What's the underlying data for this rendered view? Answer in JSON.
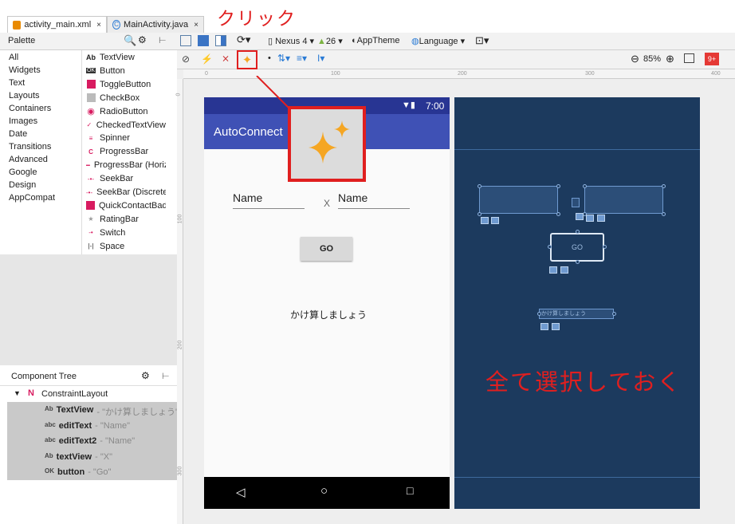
{
  "tabs": [
    {
      "label": "activity_main.xml",
      "close": "×"
    },
    {
      "label": "MainActivity.java",
      "close": "×"
    }
  ],
  "annotation": {
    "click": "クリック",
    "select_all": "全て選択しておく"
  },
  "palette": {
    "title": "Palette",
    "categories": [
      "All",
      "Widgets",
      "Text",
      "Layouts",
      "Containers",
      "Images",
      "Date",
      "Transitions",
      "Advanced",
      "Google",
      "Design",
      "AppCompat"
    ],
    "items": [
      {
        "icon": "Ab",
        "label": "TextView"
      },
      {
        "icon": "OK",
        "label": "Button"
      },
      {
        "icon": "toggle",
        "label": "ToggleButton"
      },
      {
        "icon": "check",
        "label": "CheckBox"
      },
      {
        "icon": "radio",
        "label": "RadioButton"
      },
      {
        "icon": "checked",
        "label": "CheckedTextView"
      },
      {
        "icon": "spinner",
        "label": "Spinner"
      },
      {
        "icon": "progress",
        "label": "ProgressBar"
      },
      {
        "icon": "progressh",
        "label": "ProgressBar (Horizontal)"
      },
      {
        "icon": "seek",
        "label": "SeekBar"
      },
      {
        "icon": "seekd",
        "label": "SeekBar (Discrete)"
      },
      {
        "icon": "qcb",
        "label": "QuickContactBadge"
      },
      {
        "icon": "star",
        "label": "RatingBar"
      },
      {
        "icon": "switch",
        "label": "Switch"
      },
      {
        "icon": "space",
        "label": "Space"
      }
    ]
  },
  "toolbar": {
    "device": "Nexus 4",
    "api": "26",
    "theme": "AppTheme",
    "language": "Language",
    "zoom": "85%",
    "badge": "9+"
  },
  "ruler": {
    "marks": [
      "0",
      "100",
      "200",
      "300",
      "400"
    ],
    "vmarks": [
      "0",
      "100",
      "200",
      "300"
    ]
  },
  "phone": {
    "time": "7:00",
    "app_title": "AutoConnect",
    "name1": "Name",
    "x_label": "X",
    "name2": "Name",
    "go": "GO",
    "text": "かけ算しましょう"
  },
  "blueprint": {
    "go": "GO",
    "text": "かけ算しましょう"
  },
  "component_tree": {
    "title": "Component Tree",
    "root": "ConstraintLayout",
    "items": [
      {
        "icon": "Ab",
        "name": "TextView",
        "value": "- \"かけ算しましょう\""
      },
      {
        "icon": "abc",
        "name": "editText",
        "value": "- \"Name\""
      },
      {
        "icon": "abc",
        "name": "editText2",
        "value": "- \"Name\""
      },
      {
        "icon": "Ab",
        "name": "textView",
        "value": "- \"X\""
      },
      {
        "icon": "OK",
        "name": "button",
        "value": "- \"Go\""
      }
    ]
  },
  "colors": {
    "annotation": "#e01f1f",
    "appbar": "#3f51b5",
    "blueprint": "#1c3a5e",
    "star": "#f5a623"
  }
}
